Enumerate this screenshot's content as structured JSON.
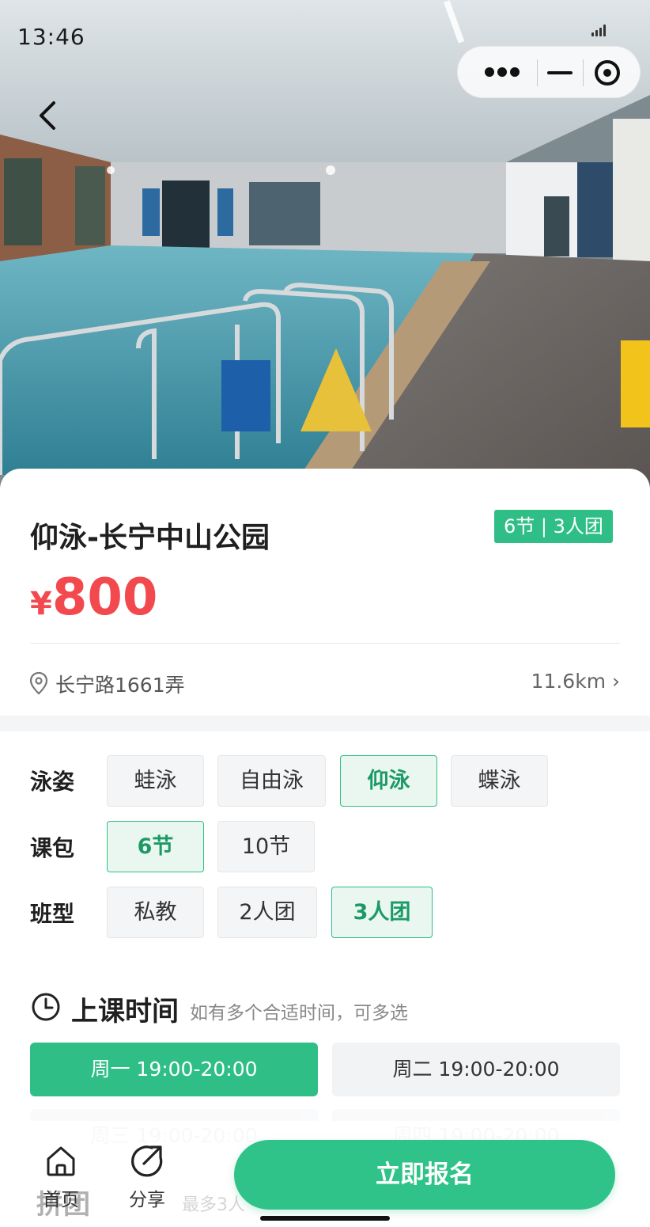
{
  "status_bar": {
    "time": "13:46"
  },
  "course": {
    "title": "仰泳-长宁中山公园",
    "tag": "6节 | 3人团",
    "currency": "¥",
    "price": "800",
    "address": "长宁路1661弄",
    "distance": "11.6km ›"
  },
  "options": {
    "stroke": {
      "label": "泳姿",
      "items": [
        "蛙泳",
        "自由泳",
        "仰泳",
        "蝶泳"
      ],
      "selected": "仰泳"
    },
    "package": {
      "label": "课包",
      "items": [
        "6节",
        "10节"
      ],
      "selected": "6节"
    },
    "class_type": {
      "label": "班型",
      "items": [
        "私教",
        "2人团",
        "3人团"
      ],
      "selected": "3人团"
    }
  },
  "schedule": {
    "title": "上课时间",
    "hint": "如有多个合适时间，可多选",
    "slots": [
      "周一 19:00-20:00",
      "周二 19:00-20:00",
      "周三 19:00-20:00",
      "周四 19:00-20:00"
    ],
    "selected": [
      "周一 19:00-20:00"
    ]
  },
  "under_tabbar": {
    "title": "拼团",
    "hint": "最多3人"
  },
  "tabbar": {
    "home": "首页",
    "share": "分享",
    "enroll": "立即报名"
  },
  "colors": {
    "accent": "#2fbf86",
    "price": "#f2494f"
  }
}
